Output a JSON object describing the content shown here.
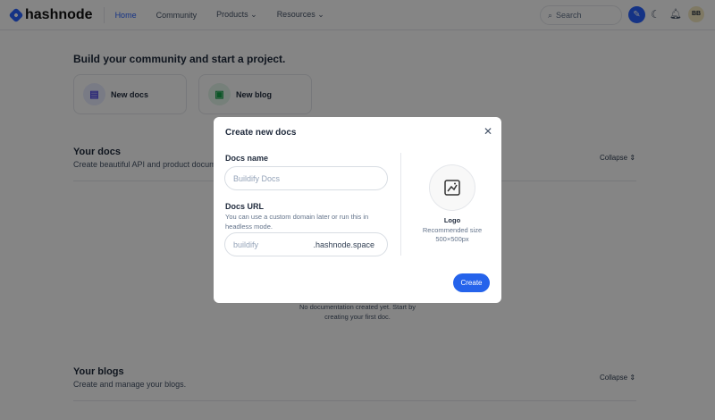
{
  "nav": {
    "brand": "hashnode",
    "items": [
      "Home",
      "Community",
      "Products",
      "Resources"
    ],
    "search_placeholder": "Search",
    "avatar": "BB"
  },
  "main": {
    "heading": "Build your community and start a project.",
    "cards": [
      "New docs",
      "New blog"
    ],
    "docs": {
      "title": "Your docs",
      "subtitle": "Create beautiful API and product documentation",
      "collapse": "Collapse",
      "empty": "No documentation created yet. Start by creating your first doc."
    },
    "blogs": {
      "title": "Your blogs",
      "subtitle": "Create and manage your blogs.",
      "collapse": "Collapse"
    }
  },
  "modal": {
    "title": "Create new docs",
    "name_label": "Docs name",
    "name_placeholder": "Buildify Docs",
    "url_label": "Docs URL",
    "url_help": "You can use a custom domain later or run this in headless mode.",
    "url_placeholder": "buildify",
    "url_suffix": ".hashnode.space",
    "logo_label": "Logo",
    "logo_hint1": "Recommended size",
    "logo_hint2": "500×500px",
    "create": "Create"
  },
  "colors": {
    "accent": "#2962ff"
  }
}
